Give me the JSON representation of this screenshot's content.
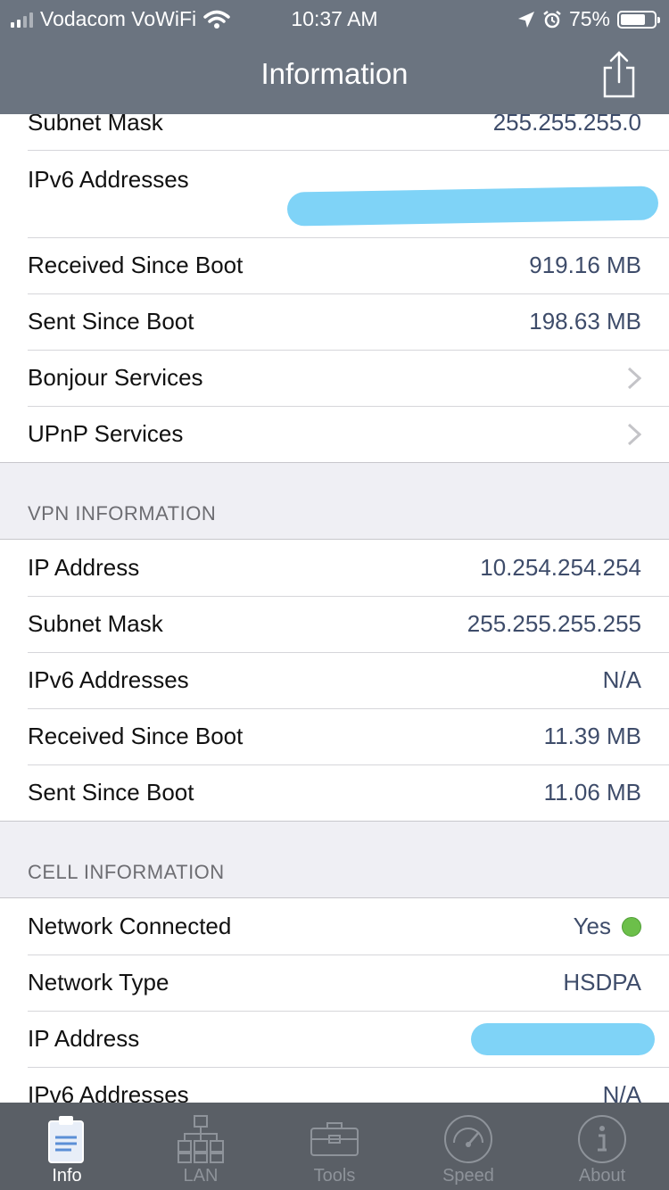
{
  "status_bar": {
    "carrier": "Vodacom VoWiFi",
    "time": "10:37 AM",
    "battery": "75%",
    "battery_level": 0.75
  },
  "nav": {
    "title": "Information"
  },
  "network_section": {
    "rows": [
      {
        "label": "Subnet Mask",
        "value": "255.255.255.0"
      },
      {
        "label": "IPv6 Addresses",
        "value": ""
      },
      {
        "label": "Received Since Boot",
        "value": "919.16 MB"
      },
      {
        "label": "Sent Since Boot",
        "value": "198.63 MB"
      },
      {
        "label": "Bonjour Services"
      },
      {
        "label": "UPnP Services"
      }
    ]
  },
  "vpn_section": {
    "header": "VPN INFORMATION",
    "rows": [
      {
        "label": "IP Address",
        "value": "10.254.254.254"
      },
      {
        "label": "Subnet Mask",
        "value": "255.255.255.255"
      },
      {
        "label": "IPv6 Addresses",
        "value": "N/A"
      },
      {
        "label": "Received Since Boot",
        "value": "11.39 MB"
      },
      {
        "label": "Sent Since Boot",
        "value": "11.06 MB"
      }
    ]
  },
  "cell_section": {
    "header": "CELL INFORMATION",
    "rows": [
      {
        "label": "Network Connected",
        "value": "Yes"
      },
      {
        "label": "Network Type",
        "value": "HSDPA"
      },
      {
        "label": "IP Address",
        "value": ""
      },
      {
        "label": "IPv6 Addresses",
        "value": "N/A"
      }
    ]
  },
  "tabbar": {
    "tabs": [
      {
        "label": "Info",
        "icon": "clipboard-icon",
        "active": true
      },
      {
        "label": "LAN",
        "icon": "network-tree-icon"
      },
      {
        "label": "Tools",
        "icon": "toolbox-icon"
      },
      {
        "label": "Speed",
        "icon": "speedometer-icon"
      },
      {
        "label": "About",
        "icon": "info-icon"
      }
    ]
  },
  "colors": {
    "nav_bar": "#6b7480",
    "tab_bar": "#5a5f66",
    "value_text": "#3e4c6a",
    "redaction": "#7fd3f7",
    "connected_dot": "#6cbf4a"
  }
}
